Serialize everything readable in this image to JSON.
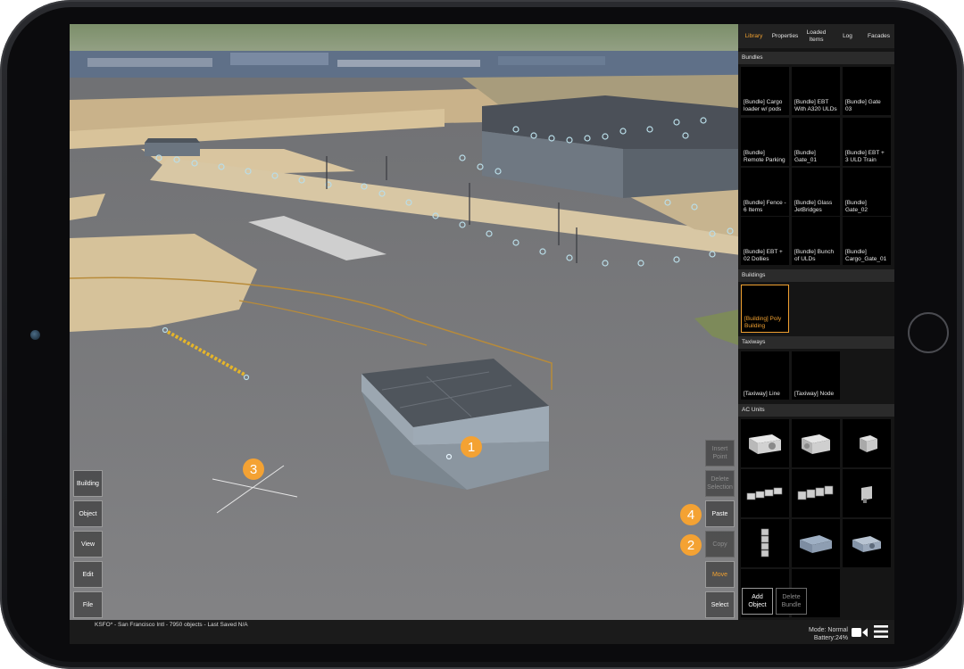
{
  "status": {
    "info": "KSFO* - San Francisco Intl - 7950 objects - Last Saved N/A",
    "mode": "Mode: Normal",
    "battery": "Battery:24%",
    "camera_icon": "video-camera-icon",
    "menu_icon": "hamburger-menu-icon"
  },
  "left_toolbar": {
    "building": "Building",
    "object": "Object",
    "view": "View",
    "edit": "Edit",
    "file": "File"
  },
  "right_toolbar": {
    "insert_point": "Insert Point",
    "delete_selection": "Delete Selection",
    "paste": "Paste",
    "copy": "Copy",
    "move": "Move",
    "select": "Select"
  },
  "badges": [
    "1",
    "2",
    "3",
    "4"
  ],
  "panel": {
    "tabs": [
      "Library",
      "Properties",
      "Loaded Items",
      "Log",
      "Facades"
    ],
    "active_tab": "Library",
    "sections": {
      "bundles": "Bundles",
      "buildings": "Buildings",
      "taxiways": "Taxiways",
      "ac_units": "AC Units"
    },
    "bundles": [
      "[Bundle] Cargo loader w/ pods",
      "[Bundle] EBT With A320 ULDs",
      "[Bundle] Gate 03",
      "[Bundle] Remote Parking",
      "[Bundle] Gate_01",
      "[Bundle] EBT + 3 ULD Train",
      "[Bundle] Fence - 6 Items",
      "[Bundle] Glass JetBridges",
      "[Bundle] Gate_02",
      "[Bundle] EBT + 02 Dollies",
      "[Bundle] Bunch of ULDs",
      "[Bundle] Cargo_Gate_01"
    ],
    "buildings": [
      "[Building] Poly Building"
    ],
    "taxiways": [
      "[Taxiway] Line",
      "[Taxiway] Node"
    ],
    "ac_units": [
      "ac-unit-icon",
      "ac-unit-icon",
      "ac-unit-icon",
      "ac-unit-icon",
      "ac-unit-icon",
      "ac-unit-icon",
      "ac-unit-icon",
      "ac-unit-icon",
      "ac-unit-icon"
    ],
    "add_object": "Add Object",
    "delete_bundle": "Delete Bundle"
  },
  "colors": {
    "accent": "#f0a030",
    "badge": "#f4a233",
    "panel_bg": "#151515"
  }
}
